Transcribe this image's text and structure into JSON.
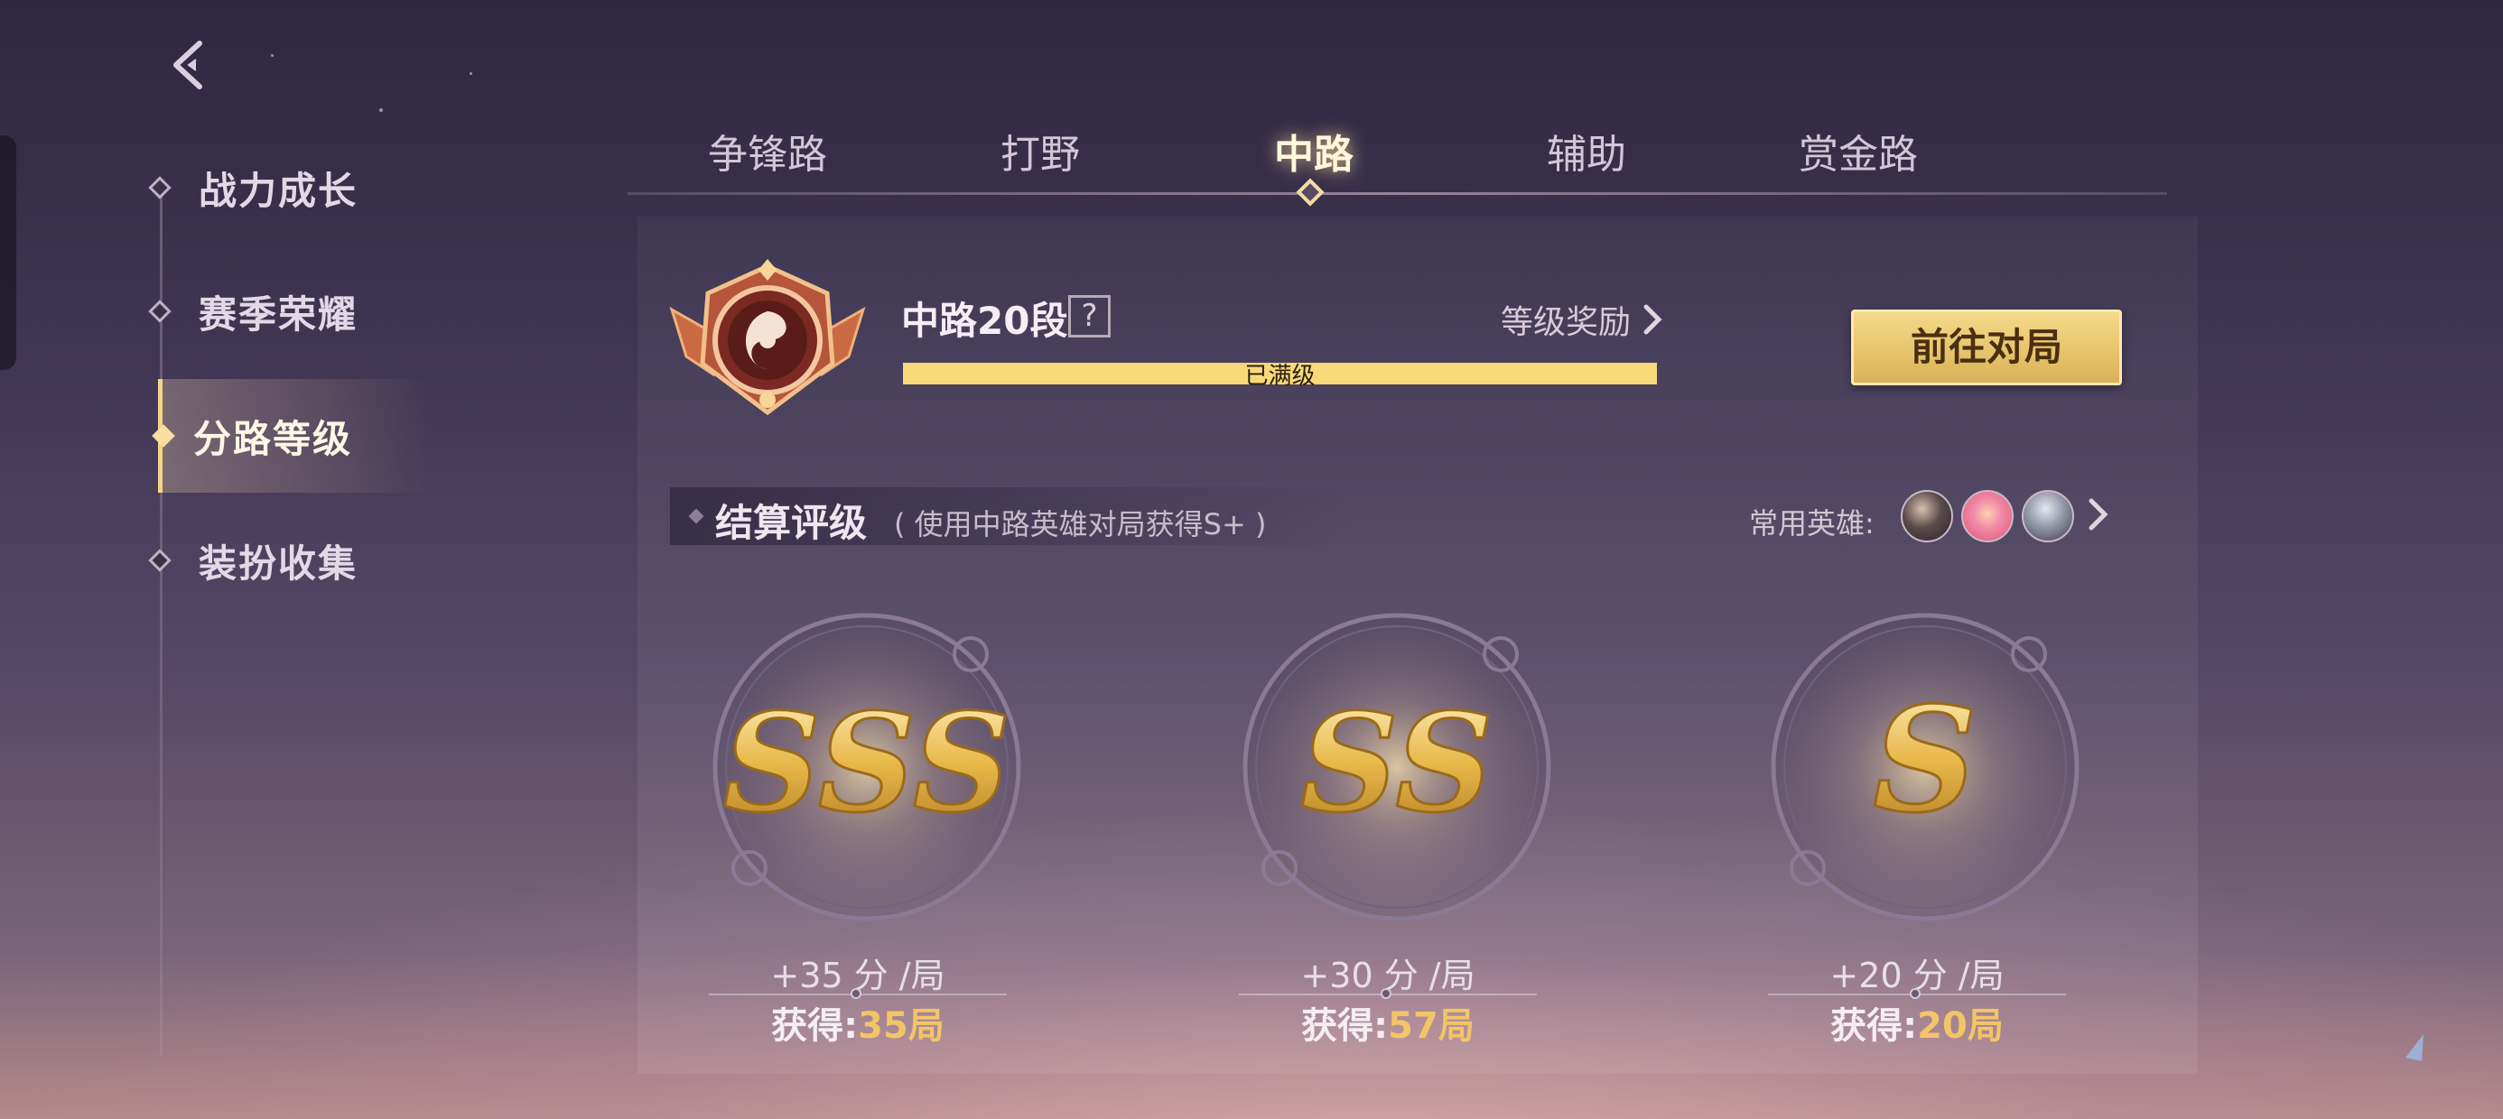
{
  "nav": {
    "items": [
      {
        "label": "战力成长"
      },
      {
        "label": "赛季荣耀"
      },
      {
        "label": "分路等级"
      },
      {
        "label": "装扮收集"
      }
    ],
    "active_index": 2
  },
  "tabs": [
    {
      "label": "争锋路"
    },
    {
      "label": "打野"
    },
    {
      "label": "中路"
    },
    {
      "label": "辅助"
    },
    {
      "label": "赏金路"
    }
  ],
  "active_tab": 2,
  "rank": {
    "title": "中路20段",
    "help": "?",
    "reward_label": "等级奖励",
    "progress": 1.0,
    "progress_text": "已满级",
    "go_button": "前往对局"
  },
  "settlement": {
    "title": "结算评级",
    "subtitle": "( 使用中路英雄对局获得S+ )",
    "heroes_label": "常用英雄:"
  },
  "grades": [
    {
      "grade": "SSS",
      "points": "+35 分 /局",
      "earned_label": "获得:",
      "earned_value": "35局"
    },
    {
      "grade": "SS",
      "points": "+30 分 /局",
      "earned_label": "获得:",
      "earned_value": "57局"
    },
    {
      "grade": "S",
      "points": "+20 分 /局",
      "earned_label": "获得:",
      "earned_value": "20局"
    }
  ],
  "colors": {
    "accent_gold": "#f3c566",
    "button_gold": "#e8c56c",
    "progress_gold": "#f7d97a"
  },
  "icons": {
    "back": "back-chevron-icon",
    "help": "question-icon",
    "reward_chevron": "chevron-right-icon",
    "heroes_chevron": "chevron-right-icon",
    "rank_badge": "mid-lane-rank-badge"
  }
}
